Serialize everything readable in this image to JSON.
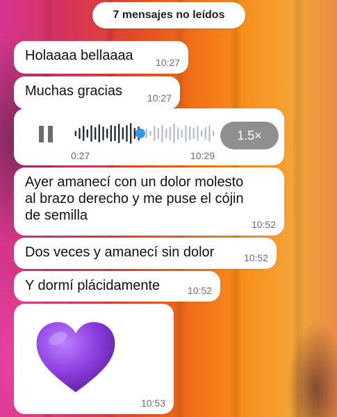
{
  "unread_banner": "7 mensajes no leídos",
  "messages": [
    {
      "text": "Holaaaa bellaaaa",
      "time": "10:27"
    },
    {
      "text": "Muchas gracias",
      "time": "10:27"
    },
    {
      "text": "Ayer amanecí con un dolor molesto al brazo derecho y me puse el cójin de semilla",
      "time": "10:52"
    },
    {
      "text": "Dos veces y amanecí sin dolor",
      "time": "10:52"
    },
    {
      "text": "Y dormí plácidamente",
      "time": "10:52"
    }
  ],
  "voice_note": {
    "elapsed": "0:27",
    "time": "10:29",
    "speed": "1.5×",
    "progress": 0.47,
    "played_color": "#1f2a44",
    "unplayed_color": "#b9c1c8",
    "thumb_color": "#2e9be6"
  },
  "sticker": {
    "icon": "purple-heart-icon",
    "color": "#8e3fe0",
    "time": "10:53"
  },
  "colors": {
    "bubble": "#ffffff",
    "timestamp": "#6d6d6d",
    "speed_pill": "#8f8f8f"
  }
}
